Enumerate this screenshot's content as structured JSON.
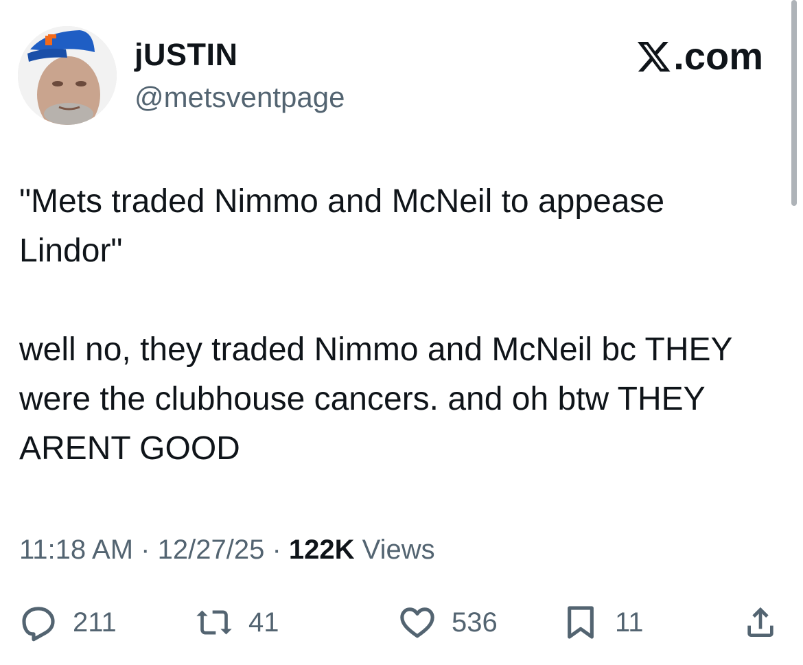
{
  "header": {
    "display_name": "jUSTIN",
    "handle": "@metsventpage",
    "brand": ".com",
    "brand_icon": "x-logo-icon"
  },
  "tweet": {
    "paragraph_1": "\"Mets traded Nimmo and McNeil to appease Lindor\"",
    "paragraph_2": "well no, they traded Nimmo and McNeil bc THEY were the clubhouse cancers. and oh btw THEY ARENT GOOD"
  },
  "meta": {
    "time": "11:18 AM",
    "date": "12/27/25",
    "separator": "·",
    "views_count": "122K",
    "views_label": "Views"
  },
  "actions": {
    "replies": "211",
    "reposts": "41",
    "likes": "536",
    "bookmarks": "11"
  },
  "colors": {
    "text": "#0f1419",
    "secondary": "#536471",
    "mets_blue": "#1f5ec4",
    "mets_orange": "#f26a1b"
  }
}
